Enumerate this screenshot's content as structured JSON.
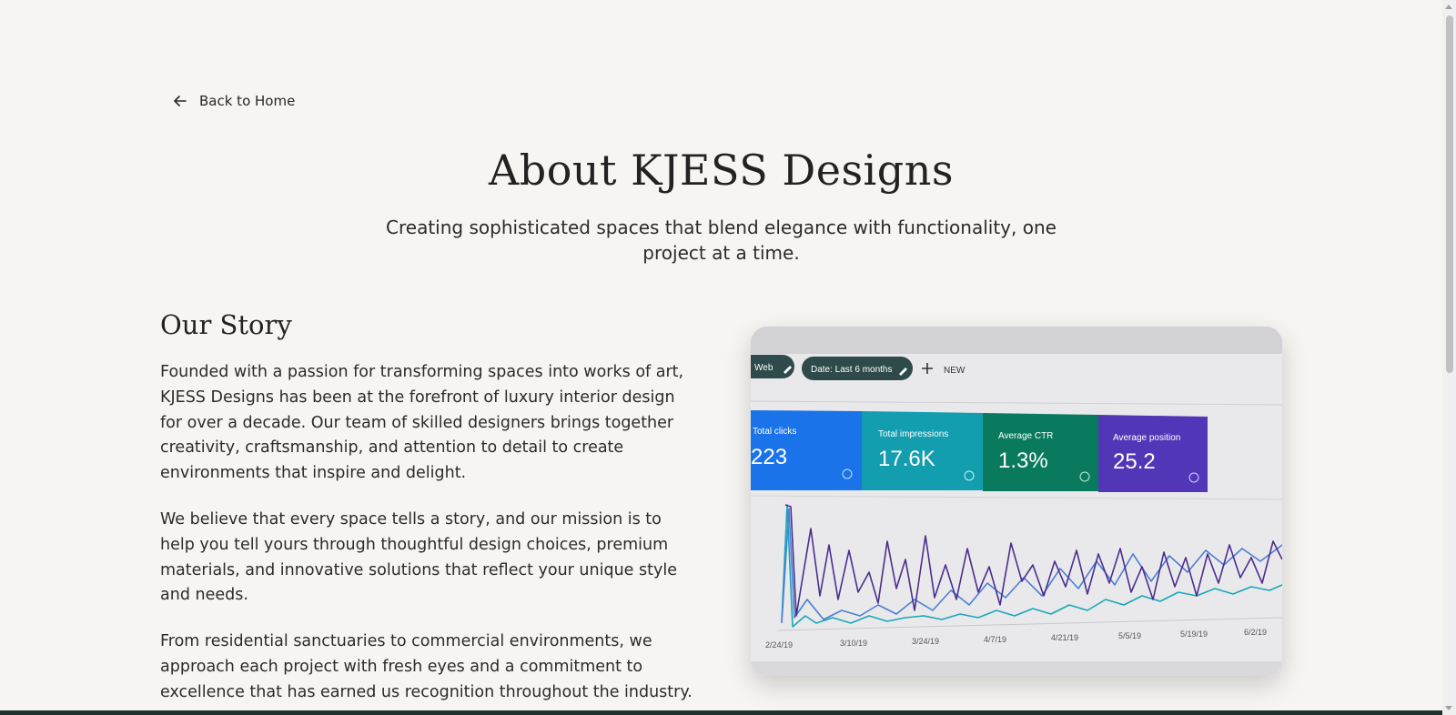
{
  "nav": {
    "back_label": "Back to Home"
  },
  "hero": {
    "title": "About KJESS Designs",
    "subtitle": "Creating sophisticated spaces that blend elegance with functionality, one project at a time."
  },
  "story": {
    "title": "Our Story",
    "paragraphs": [
      "Founded with a passion for transforming spaces into works of art, KJESS Designs has been at the forefront of luxury interior design for over a decade. Our team of skilled designers brings together creativity, craftsmanship, and attention to detail to create environments that inspire and delight.",
      "We believe that every space tells a story, and our mission is to help you tell yours through thoughtful design choices, premium materials, and innovative solutions that reflect your unique style and needs.",
      "From residential sanctuaries to commercial environments, we approach each project with fresh eyes and a commitment to excellence that has earned us recognition throughout the industry."
    ]
  },
  "photo": {
    "chips": [
      "Web",
      "Date: Last 6 months"
    ],
    "new_label": "NEW",
    "metrics": [
      {
        "label": "Total clicks",
        "value": "223",
        "color": "#1a73e8"
      },
      {
        "label": "Total impressions",
        "value": "17.6K",
        "color": "#129eaf"
      },
      {
        "label": "Average CTR",
        "value": "1.3%",
        "color": "#0a7a5f"
      },
      {
        "label": "Average position",
        "value": "25.2",
        "color": "#5137b7"
      }
    ],
    "dates": [
      "2/24/19",
      "3/10/19",
      "3/24/19",
      "4/7/19",
      "4/21/19",
      "5/5/19",
      "5/19/19",
      "6/2/19"
    ]
  },
  "colors": {
    "background": "#f6f5f2",
    "text": "#27272a",
    "accent_dark": "#1f2e2e"
  }
}
